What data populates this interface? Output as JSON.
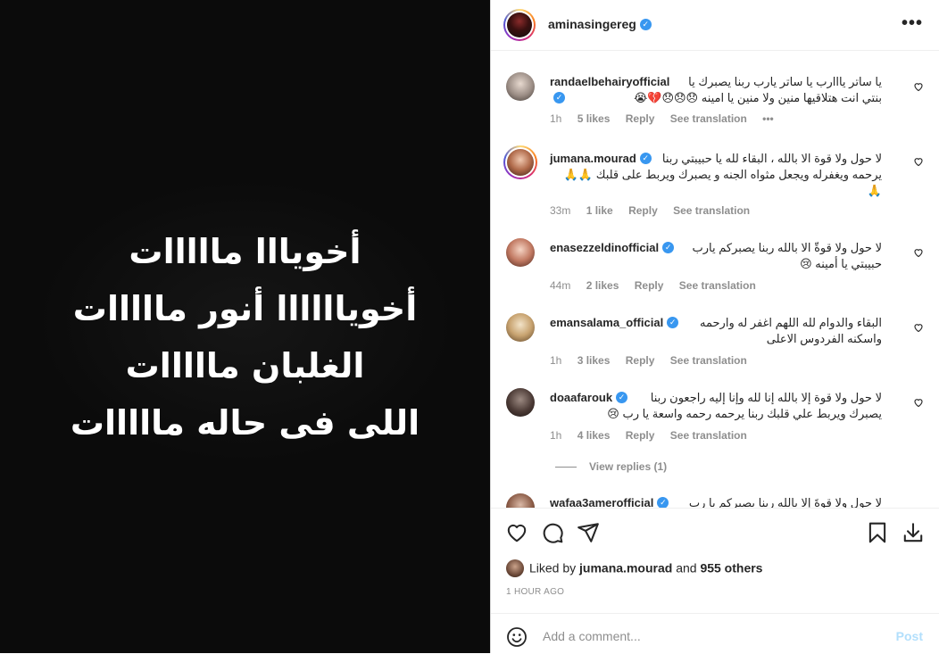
{
  "media": {
    "lines": [
      "أخويااا مااااات",
      "أخوياااااا أنور مااااات",
      "الغلبان مااااات",
      "اللى فى حاله مااااات"
    ]
  },
  "post": {
    "owner": "aminasingereg",
    "more_label": "•••"
  },
  "comments": [
    {
      "user": "randaelbehairyofficial",
      "text": "يا ساتر يااارب يا ساتر يارب ربنا يصبرك يا بنتي انت هتلاقيها منين ولا منين يا امينه 😞😞😞💔😭",
      "time": "1h",
      "likes": "5 likes",
      "reply": "Reply",
      "translate": "See translation",
      "extra": "•••"
    },
    {
      "user": "jumana.mourad",
      "text": "لا حول ولا قوة الا بالله ، البقاء لله يا حبيبتي ربنا يرحمه ويغفرله ويجعل مثواه الجنه و يصبرك ويربط على قلبك 🙏🙏🙏",
      "time": "33m",
      "likes": "1 like",
      "reply": "Reply",
      "translate": "See translation"
    },
    {
      "user": "enasezzeldinofficial",
      "text": "لا حول ولا قوةّ الا بالله ربنا يصبركم يارب حبيبتي يا أمينه 😢",
      "time": "44m",
      "likes": "2 likes",
      "reply": "Reply",
      "translate": "See translation"
    },
    {
      "user": "emansalama_official",
      "text": "البقاء والدوام لله اللهم اغفر له وارحمه واسكنه الفردوس الاعلى",
      "time": "1h",
      "likes": "3 likes",
      "reply": "Reply",
      "translate": "See translation"
    },
    {
      "user": "doaafarouk",
      "text": "لا حول ولا قوة إلا بالله إنا لله وإنا إليه راجعون ربنا يصبرك ويربط علي قلبك ربنا يرحمه رحمه واسعة يا رب 😢",
      "time": "1h",
      "likes": "4 likes",
      "reply": "Reply",
      "translate": "See translation"
    },
    {
      "user": "wafaa3amerofficial",
      "text": "لا حول ولا قوةَ إلا بالله ربنا يصبركم يا رب"
    }
  ],
  "view_replies": "View replies (1)",
  "likes": {
    "prefix": "Liked by",
    "user": "jumana.mourad",
    "and": "and",
    "others": "955 others"
  },
  "time_ago": "1 HOUR AGO",
  "add_comment": {
    "placeholder": "Add a comment...",
    "post_label": "Post"
  },
  "colors": {
    "verified": "#3897f0",
    "post_disabled": "#b2dffc",
    "meta_text": "#8e8e8e",
    "media_bg": "#0b0b0b"
  }
}
